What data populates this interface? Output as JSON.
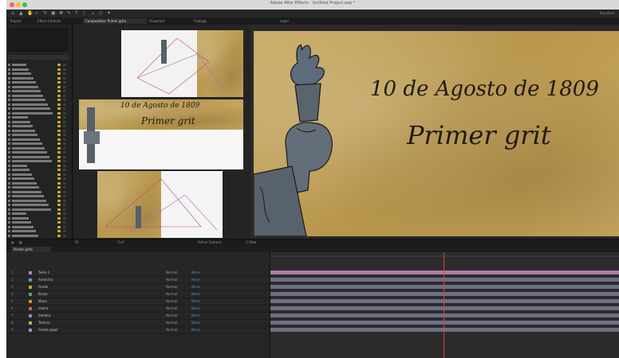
{
  "app": {
    "window_title": "Adobe After Effects - Untitled Project.aep *",
    "workspace_label": "Standard"
  },
  "toolbar": {
    "icons": [
      "home-icon",
      "selection-icon",
      "hand-icon",
      "zoom-icon",
      "rotate-icon",
      "camera-icon",
      "pan-icon",
      "pen-icon",
      "text-icon",
      "brush-icon",
      "stamp-icon",
      "eraser-icon",
      "puppet-icon"
    ]
  },
  "tabs": [
    {
      "label": "Project"
    },
    {
      "label": "Effect Controls"
    },
    {
      "label": "Composition: Primer grito"
    },
    {
      "label": "Flowchart"
    },
    {
      "label": "Footage"
    },
    {
      "label": "Layer"
    }
  ],
  "viewer": {
    "headline": "10 de Agosto de 1809",
    "subtitle": "Primer grit",
    "colors": {
      "parchment": "#c7aa64",
      "torch_body": "#56606a",
      "ink": "#1f1a12"
    }
  },
  "viewer_bar": {
    "zoom": "Fit",
    "quality": "Full",
    "camera": "Active Camera",
    "views": "1 View"
  },
  "timeline": {
    "comp_tab": "Primer grito",
    "layers": [
      {
        "num": "1",
        "name": "Texto 1",
        "color": "#c47cc4",
        "mode": "Normal",
        "parent": "None"
      },
      {
        "num": "2",
        "name": "Antorcha",
        "color": "#6b8ed6",
        "mode": "Normal",
        "parent": "None"
      },
      {
        "num": "3",
        "name": "Fondo",
        "color": "#c9a52a",
        "mode": "Normal",
        "parent": "None"
      },
      {
        "num": "4",
        "name": "Brazo",
        "color": "#4aa56a",
        "mode": "Normal",
        "parent": "None"
      },
      {
        "num": "5",
        "name": "Mano",
        "color": "#d08a3a",
        "mode": "Normal",
        "parent": "None"
      },
      {
        "num": "6",
        "name": "Llama",
        "color": "#d35a5a",
        "mode": "Normal",
        "parent": "None"
      },
      {
        "num": "7",
        "name": "Sombra",
        "color": "#8a8ad0",
        "mode": "Normal",
        "parent": "None"
      },
      {
        "num": "8",
        "name": "Textura",
        "color": "#9ac04a",
        "mode": "Normal",
        "parent": "None"
      },
      {
        "num": "9",
        "name": "Fondo papel",
        "color": "#c47cc4",
        "mode": "Normal",
        "parent": "None"
      }
    ]
  }
}
